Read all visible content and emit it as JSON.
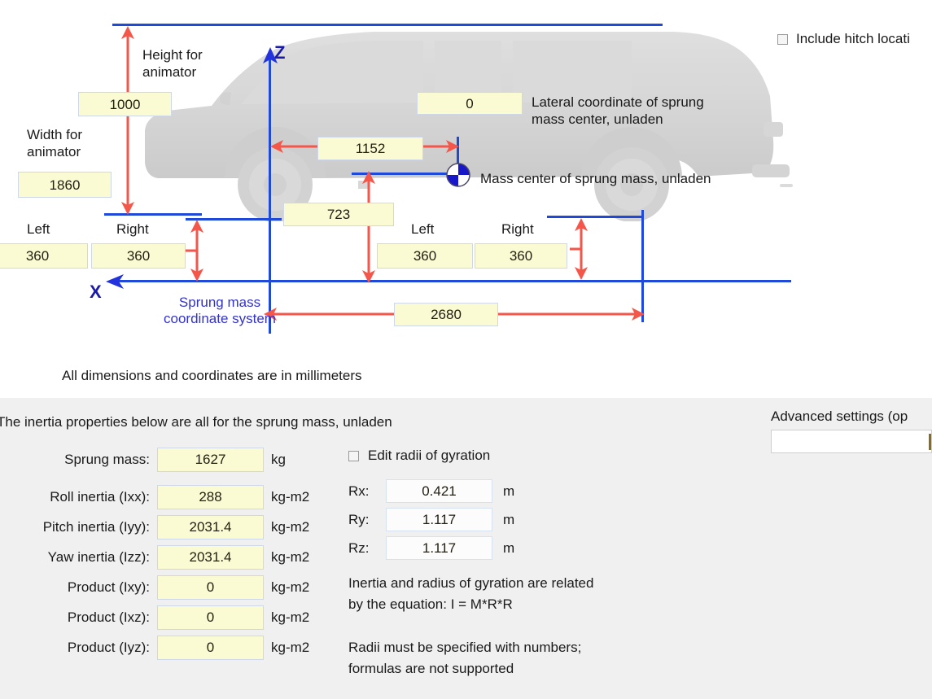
{
  "diagram": {
    "units_note": "All dimensions and coordinates are in millimeters",
    "height_for_animator_label": "Height for\nanimator",
    "height_for_animator_value": "1000",
    "width_for_animator_label": "Width for\nanimator",
    "width_for_animator_value": "1860",
    "lateral_coord_label": "Lateral coordinate of sprung\nmass center, unladen",
    "lateral_coord_value": "0",
    "mass_center_label": "Mass center of sprung mass, unladen",
    "x_dim_value": "1152",
    "z_dim_value": "723",
    "wheelbase_value": "2680",
    "front_left_label": "Left",
    "front_right_label": "Right",
    "front_left_value": "360",
    "front_right_value": "360",
    "rear_left_label": "Left",
    "rear_right_label": "Right",
    "rear_left_value": "360",
    "rear_right_value": "360",
    "axis_z": "Z",
    "axis_x": "X",
    "coord_system_caption": "Sprung mass\ncoordinate system",
    "include_hitch_label": "Include hitch locati",
    "mass_center_icon": "mass-center-quadrant-icon",
    "accent_blue": "#1f49d8",
    "accent_red": "#f4564a",
    "field_yellow": "#fbfbd3"
  },
  "properties": {
    "heading": "The inertia properties below are all for the sprung mass, unladen",
    "inertia_rows": [
      {
        "label": "Sprung mass:",
        "value": "1627",
        "unit": "kg"
      },
      {
        "label": "Roll inertia (Ixx):",
        "value": "288",
        "unit": "kg-m2"
      },
      {
        "label": "Pitch inertia (Iyy):",
        "value": "2031.4",
        "unit": "kg-m2"
      },
      {
        "label": "Yaw inertia (Izz):",
        "value": "2031.4",
        "unit": "kg-m2"
      },
      {
        "label": "Product (Ixy):",
        "value": "0",
        "unit": "kg-m2"
      },
      {
        "label": "Product (Ixz):",
        "value": "0",
        "unit": "kg-m2"
      },
      {
        "label": "Product (Iyz):",
        "value": "0",
        "unit": "kg-m2"
      }
    ],
    "edit_radii_label": "Edit radii of gyration",
    "radii_rows": [
      {
        "label": "Rx:",
        "value": "0.421",
        "unit": "m"
      },
      {
        "label": "Ry:",
        "value": "1.117",
        "unit": "m"
      },
      {
        "label": "Rz:",
        "value": "1.117",
        "unit": "m"
      }
    ],
    "relation_note": "Inertia and radius of gyration are related\nby the equation: I = M*R*R",
    "formula_note": "Radii must be specified with numbers;\nformulas are not supported",
    "advanced_label": "Advanced settings (op",
    "advanced_value": ""
  }
}
